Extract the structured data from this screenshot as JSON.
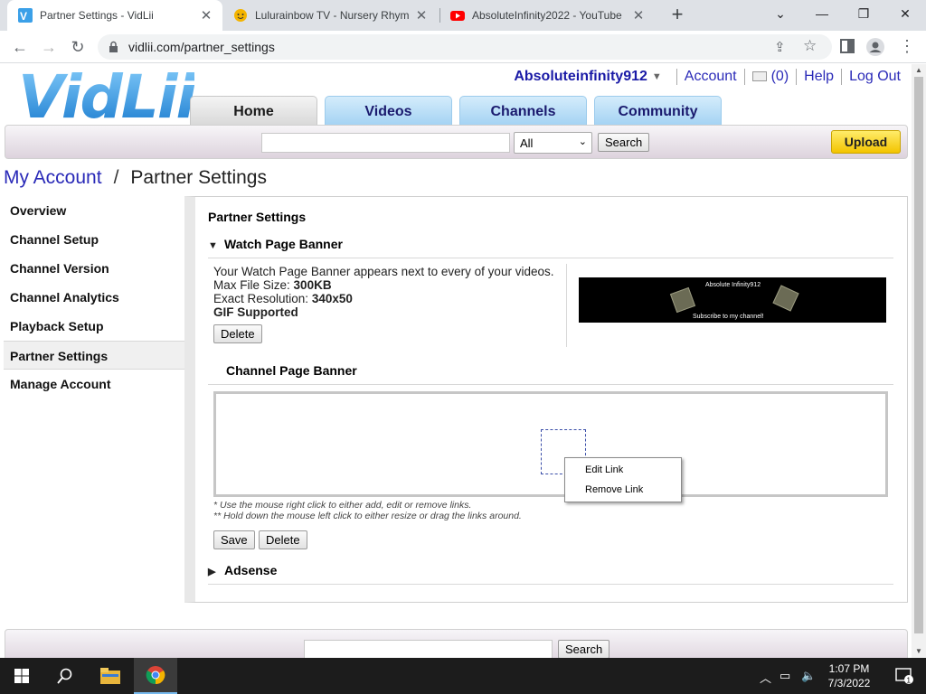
{
  "browser": {
    "tabs": [
      {
        "title": "Partner Settings - VidLii",
        "active": true
      },
      {
        "title": "Lulurainbow TV - Nursery Rhyme",
        "active": false
      },
      {
        "title": "AbsoluteInfinity2022 - YouTube",
        "active": false
      }
    ],
    "url": "vidlii.com/partner_settings"
  },
  "site": {
    "logo": "VidLii",
    "user": {
      "name": "Absoluteinfinity912",
      "account": "Account",
      "inbox": "(0)",
      "help": "Help",
      "logout": "Log Out"
    },
    "nav": [
      "Home",
      "Videos",
      "Channels",
      "Community"
    ],
    "search": {
      "category": "All",
      "button": "Search"
    },
    "upload": "Upload"
  },
  "breadcrumb": {
    "parent": "My Account",
    "separator": "/",
    "current": "Partner Settings"
  },
  "sidebar": {
    "items": [
      {
        "label": "Overview"
      },
      {
        "label": "Channel Setup"
      },
      {
        "label": "Channel Version"
      },
      {
        "label": "Channel Analytics"
      },
      {
        "label": "Playback Setup"
      },
      {
        "label": "Partner Settings"
      },
      {
        "label": "Manage Account"
      }
    ],
    "active_index": 5
  },
  "main": {
    "heading": "Partner Settings",
    "watch_banner": {
      "title": "Watch Page Banner",
      "desc": "Your Watch Page Banner appears next to every of your videos.",
      "size_label": "Max File Size:",
      "size_value": "300KB",
      "res_label": "Exact Resolution:",
      "res_value": "340x50",
      "gif": "GIF Supported",
      "delete": "Delete",
      "preview_title": "Absolute Infinity912",
      "preview_sub": "Subscribe to my channel!"
    },
    "channel_banner": {
      "title": "Channel Page Banner",
      "note1": "* Use the mouse right click to either add, edit or remove links.",
      "note2": "** Hold down the mouse left click to either resize or drag the links around.",
      "save": "Save",
      "delete": "Delete"
    },
    "context_menu": [
      "Edit Link",
      "Remove Link"
    ],
    "adsense": {
      "title": "Adsense"
    }
  },
  "footer": {
    "search_button": "Search"
  },
  "taskbar": {
    "time": "1:07 PM",
    "date": "7/3/2022",
    "notifications": "1"
  },
  "colors": {
    "link": "#2a2ab8",
    "username": "#1a1aa6",
    "nav_blue": "#a3d2f3",
    "upload_yellow": "#f3c400",
    "logo_blue": "#3ba0e8"
  }
}
